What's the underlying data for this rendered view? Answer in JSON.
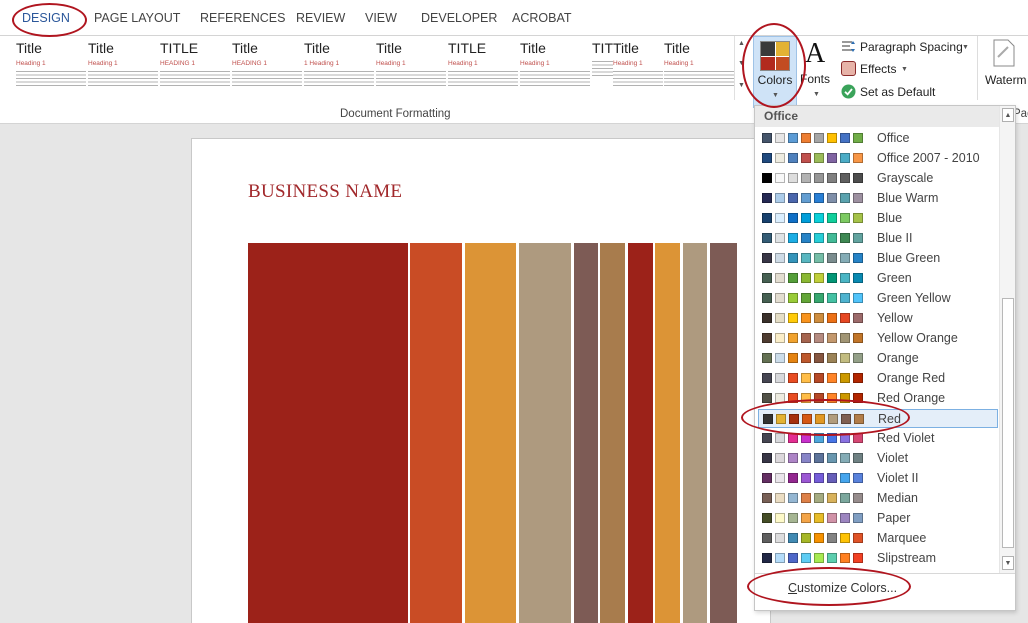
{
  "tabs": [
    {
      "id": "design",
      "label": "DESIGN",
      "active": true
    },
    {
      "id": "page-layout",
      "label": "PAGE LAYOUT"
    },
    {
      "id": "references",
      "label": "REFERENCES"
    },
    {
      "id": "review",
      "label": "REVIEW"
    },
    {
      "id": "view",
      "label": "VIEW"
    },
    {
      "id": "developer",
      "label": "DEVELOPER"
    },
    {
      "id": "acrobat",
      "label": "ACROBAT"
    }
  ],
  "style_gallery": [
    {
      "title": "Title",
      "heading": "Heading 1"
    },
    {
      "title": "Title",
      "heading": "Heading 1"
    },
    {
      "title": "TITLE",
      "heading": "HEADING 1"
    },
    {
      "title": "Title",
      "heading": "HEADING 1"
    },
    {
      "title": "Title",
      "heading": "1 Heading 1"
    },
    {
      "title": "Title",
      "heading": "Heading 1"
    },
    {
      "title": "TITLE",
      "heading": "Heading 1"
    },
    {
      "title": "Title",
      "heading": "Heading 1"
    },
    {
      "title": "TITLE",
      "heading": ""
    },
    {
      "title": "Title",
      "heading": "Heading 1"
    },
    {
      "title": "Title",
      "heading": "Heading 1"
    }
  ],
  "ribbon": {
    "colors_label": "Colors",
    "colors_icon_colors": [
      "#3a3a3a",
      "#e3b234",
      "#b22a1e",
      "#c34c22"
    ],
    "fonts_glyph": "A",
    "fonts_label": "Fonts",
    "paragraph_spacing_label": "Paragraph Spacing",
    "effects_label": "Effects",
    "set_as_default_label": "Set as Default",
    "watermark_label": "Waterm",
    "page_label": "Pag",
    "group_label": "Document Formatting"
  },
  "document": {
    "business_name": "BUSINESS NAME",
    "bar_colors": [
      "#9c2219",
      "#c94c25",
      "#dc9436",
      "#ae9a7f",
      "#7d5b55",
      "#a87c4d",
      "#9c2219",
      "#dc9436",
      "#ae9a7f",
      "#7d5b55"
    ]
  },
  "dropdown": {
    "header": "Office",
    "customize_label": "Customize Colors...",
    "customize_mnemonic": "C",
    "customize_rest": "ustomize Colors...",
    "selected": "Red",
    "themes": [
      {
        "name": "Office",
        "colors": [
          "#44546a",
          "#e7e6e6",
          "#5b9bd5",
          "#ed7d31",
          "#a5a5a5",
          "#ffc000",
          "#4472c4",
          "#70ad47"
        ]
      },
      {
        "name": "Office 2007 - 2010",
        "colors": [
          "#1f497d",
          "#eeece1",
          "#4f81bd",
          "#c0504d",
          "#9bbb59",
          "#8064a2",
          "#4bacc6",
          "#f79646"
        ]
      },
      {
        "name": "Grayscale",
        "colors": [
          "#000000",
          "#f8f8f8",
          "#dddddd",
          "#b2b2b2",
          "#969696",
          "#808080",
          "#5f5f5f",
          "#4d4d4d"
        ]
      },
      {
        "name": "Blue Warm",
        "colors": [
          "#242852",
          "#acccea",
          "#4a66ac",
          "#629dd1",
          "#297fd5",
          "#7f8fa9",
          "#5aa2ae",
          "#9d90a0"
        ]
      },
      {
        "name": "Blue",
        "colors": [
          "#17406d",
          "#dbefff",
          "#0f6fc6",
          "#009dd9",
          "#0bd0d9",
          "#10cf9b",
          "#7cca62",
          "#a5c249"
        ]
      },
      {
        "name": "Blue II",
        "colors": [
          "#335b74",
          "#dfe3e5",
          "#1cade4",
          "#2683c6",
          "#27ced7",
          "#42ba97",
          "#3e8853",
          "#62a39f"
        ]
      },
      {
        "name": "Blue Green",
        "colors": [
          "#373545",
          "#cedbe6",
          "#3494ba",
          "#58b6c0",
          "#75bda7",
          "#7a8c8e",
          "#84acb6",
          "#2683c6"
        ]
      },
      {
        "name": "Green",
        "colors": [
          "#455f51",
          "#e3ded1",
          "#549e39",
          "#8ab833",
          "#c0cf3a",
          "#029676",
          "#4ab5c4",
          "#0989b1"
        ]
      },
      {
        "name": "Green Yellow",
        "colors": [
          "#455f51",
          "#e3ded1",
          "#99cb38",
          "#63a537",
          "#37a76f",
          "#44c1a3",
          "#4eb3cf",
          "#51c3f9"
        ]
      },
      {
        "name": "Yellow",
        "colors": [
          "#39302a",
          "#e5dec6",
          "#ffca08",
          "#f8931d",
          "#ce8d3e",
          "#ec7016",
          "#e64823",
          "#9c6a6a"
        ]
      },
      {
        "name": "Yellow Orange",
        "colors": [
          "#4e3b30",
          "#fbeec9",
          "#f0a22e",
          "#a5644e",
          "#b58b80",
          "#c3986d",
          "#a19574",
          "#c17529"
        ]
      },
      {
        "name": "Orange",
        "colors": [
          "#637052",
          "#ccddea",
          "#e48312",
          "#bd582c",
          "#865640",
          "#9b8357",
          "#c2bc80",
          "#94a088"
        ]
      },
      {
        "name": "Orange Red",
        "colors": [
          "#454551",
          "#d8d9dc",
          "#e84c22",
          "#ffbd47",
          "#b64926",
          "#ff8427",
          "#cc9900",
          "#b22600"
        ]
      },
      {
        "name": "Red Orange",
        "colors": [
          "#505046",
          "#eeece1",
          "#e84c22",
          "#ffbd47",
          "#b64926",
          "#ff8427",
          "#cc9900",
          "#b22600"
        ]
      },
      {
        "name": "Red",
        "colors": [
          "#323232",
          "#e3b234",
          "#a5300f",
          "#d55816",
          "#e19825",
          "#b19c7d",
          "#7f5f52",
          "#b27d49"
        ]
      },
      {
        "name": "Red Violet",
        "colors": [
          "#454551",
          "#d8d9dc",
          "#e32d91",
          "#c830cc",
          "#4ea6dc",
          "#4775e7",
          "#8971e1",
          "#d54773"
        ]
      },
      {
        "name": "Violet",
        "colors": [
          "#373545",
          "#dcd8dc",
          "#ad84c6",
          "#8784c7",
          "#5d739a",
          "#6997af",
          "#84acb6",
          "#6f8183"
        ]
      },
      {
        "name": "Violet II",
        "colors": [
          "#632e62",
          "#eae5eb",
          "#92278f",
          "#9b57d3",
          "#755dd9",
          "#665eb8",
          "#45a5ed",
          "#5982db"
        ]
      },
      {
        "name": "Median",
        "colors": [
          "#775f55",
          "#ebddc3",
          "#94b6d2",
          "#dd8047",
          "#a5ab81",
          "#d8b25c",
          "#7ba79d",
          "#968c8c"
        ]
      },
      {
        "name": "Paper",
        "colors": [
          "#444d26",
          "#fefac9",
          "#a5b592",
          "#f3a447",
          "#e7bc29",
          "#d092a7",
          "#9c85c0",
          "#809ec2"
        ]
      },
      {
        "name": "Marquee",
        "colors": [
          "#5e5e5e",
          "#ddddde",
          "#418ab3",
          "#a6b727",
          "#f69200",
          "#838383",
          "#fec306",
          "#df5327"
        ]
      },
      {
        "name": "Slipstream",
        "colors": [
          "#212745",
          "#b4dcfa",
          "#4e67c8",
          "#5eccf3",
          "#a7ea52",
          "#5dceaf",
          "#ff8021",
          "#f14124"
        ]
      }
    ]
  }
}
